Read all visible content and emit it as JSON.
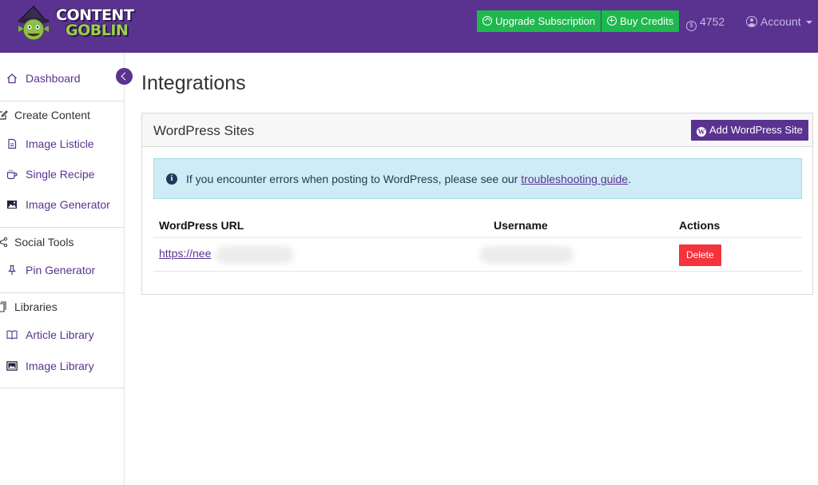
{
  "header": {
    "logo": {
      "line1": "CONTENT",
      "line2": "GOBLIN",
      "mascot": "goblin-mascot-icon"
    },
    "upgrade_label": "Upgrade Subscription",
    "buy_credits_label": "Buy Credits",
    "credits": "4752",
    "account_label": "Account"
  },
  "sidebar": {
    "dashboard": "Dashboard",
    "create_content": "Create Content",
    "image_listicle": "Image Listicle",
    "single_recipe": "Single Recipe",
    "image_generator": "Image Generator",
    "social_tools": "Social Tools",
    "pin_generator": "Pin Generator",
    "libraries": "Libraries",
    "article_library": "Article Library",
    "image_library": "Image Library"
  },
  "main": {
    "title": "Integrations",
    "card_title": "WordPress Sites",
    "add_site_label": "Add WordPress Site",
    "alert": {
      "text_before": "If you encounter errors when posting to WordPress, please see our ",
      "link_text": "troubleshooting guide",
      "text_after": "."
    },
    "table": {
      "headers": {
        "url": "WordPress URL",
        "username": "Username",
        "actions": "Actions"
      },
      "rows": [
        {
          "url": "https://nee",
          "delete_label": "Delete"
        }
      ]
    }
  },
  "colors": {
    "brand_purple": "#5a3391",
    "green": "#1fb84f",
    "danger": "#f4333d",
    "info_bg": "#cfebf6"
  }
}
